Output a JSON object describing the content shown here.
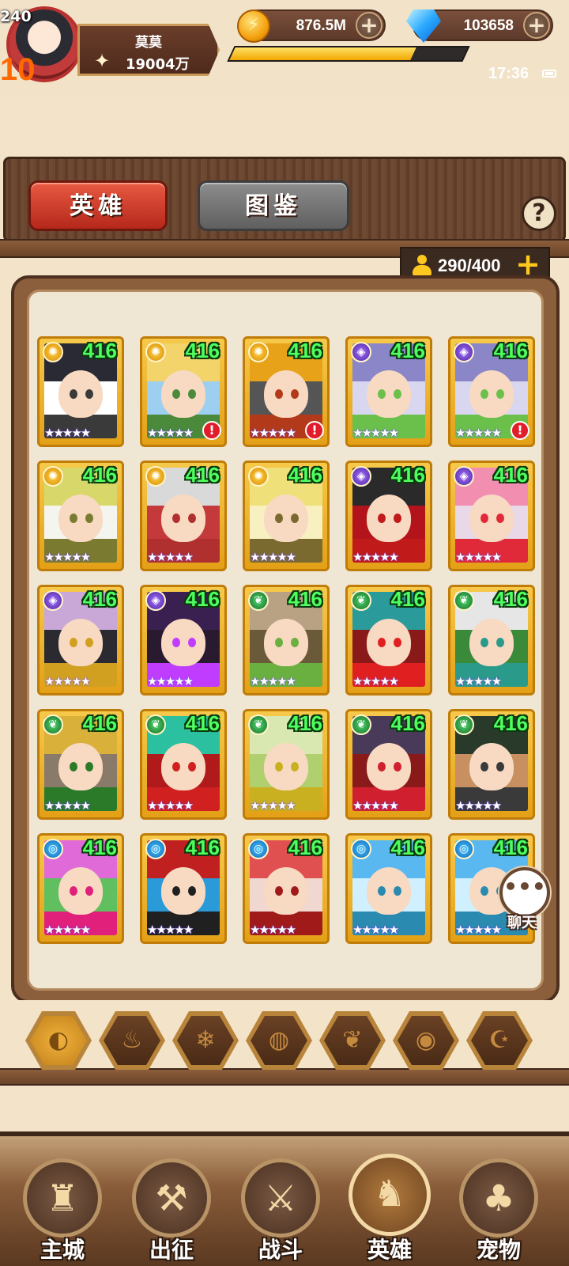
{
  "player": {
    "level": "240",
    "vip": "10",
    "name": "莫莫",
    "power": "19004万",
    "exp_progress": 0.78
  },
  "currency": {
    "gold": "876.5M",
    "diamonds": "103658"
  },
  "clock": "17:36",
  "tabs": {
    "hero": "英雄",
    "codex": "图鉴"
  },
  "help_label": "?",
  "capacity": {
    "count": "290/400"
  },
  "chat": {
    "label": "聊天"
  },
  "heroes": [
    {
      "level": "416",
      "stars": "★★★★★",
      "element": "light",
      "alert": false
    },
    {
      "level": "416",
      "stars": "★★★★★",
      "element": "light",
      "alert": true
    },
    {
      "level": "416",
      "stars": "★★★★★",
      "element": "light",
      "alert": true
    },
    {
      "level": "416",
      "stars": "★★★★★",
      "element": "dark",
      "alert": false
    },
    {
      "level": "416",
      "stars": "★★★★★",
      "element": "dark",
      "alert": true
    },
    {
      "level": "416",
      "stars": "★★★★★",
      "element": "light",
      "alert": false
    },
    {
      "level": "416",
      "stars": "★★★★★",
      "element": "light",
      "alert": false
    },
    {
      "level": "416",
      "stars": "★★★★★",
      "element": "light",
      "alert": false
    },
    {
      "level": "416",
      "stars": "★★★★★",
      "element": "dark",
      "alert": false
    },
    {
      "level": "416",
      "stars": "★★★★★",
      "element": "dark",
      "alert": false
    },
    {
      "level": "416",
      "stars": "★★★★★",
      "element": "dark",
      "alert": false
    },
    {
      "level": "416",
      "stars": "★★★★★",
      "element": "dark",
      "alert": false
    },
    {
      "level": "416",
      "stars": "★★★★★",
      "element": "nature",
      "alert": false
    },
    {
      "level": "416",
      "stars": "★★★★★",
      "element": "nature",
      "alert": false
    },
    {
      "level": "416",
      "stars": "★★★★★",
      "element": "nature",
      "alert": false
    },
    {
      "level": "416",
      "stars": "★★★★★",
      "element": "nature",
      "alert": false
    },
    {
      "level": "416",
      "stars": "★★★★★",
      "element": "nature",
      "alert": false
    },
    {
      "level": "416",
      "stars": "★★★★★",
      "element": "nature",
      "alert": false
    },
    {
      "level": "416",
      "stars": "★★★★★",
      "element": "nature",
      "alert": false
    },
    {
      "level": "416",
      "stars": "★★★★★",
      "element": "nature",
      "alert": false
    },
    {
      "level": "416",
      "stars": "★★★★★",
      "element": "water",
      "alert": false
    },
    {
      "level": "416",
      "stars": "★★★★★",
      "element": "water",
      "alert": false
    },
    {
      "level": "416",
      "stars": "★★★★★",
      "element": "water",
      "alert": false
    },
    {
      "level": "416",
      "stars": "★★★★★",
      "element": "water",
      "alert": false
    },
    {
      "level": "416",
      "stars": "★★★★★",
      "element": "water",
      "alert": false
    }
  ],
  "filters": [
    "all",
    "fire",
    "ice",
    "wind",
    "nature",
    "dark-eye",
    "light-swirl"
  ],
  "nav": [
    "主城",
    "出征",
    "战斗",
    "英雄",
    "宠物"
  ],
  "colors": {
    "level_text": "#4dff5f",
    "active_tab": "#d2402c",
    "inactive_tab": "#777777",
    "frame_gold": "#f2b52a"
  }
}
